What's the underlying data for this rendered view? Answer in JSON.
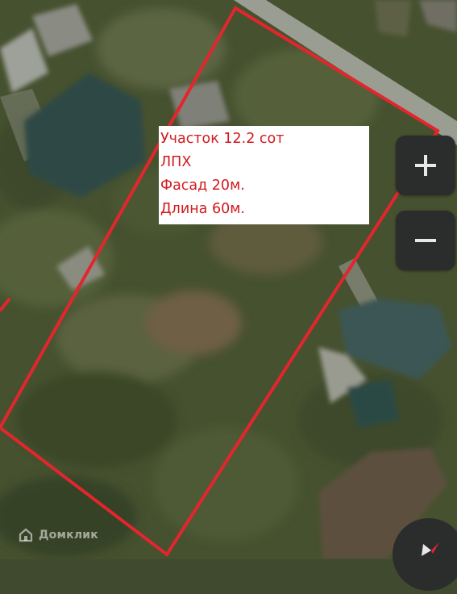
{
  "map": {
    "view": "satellite",
    "plot_outline_color": "#e3262d"
  },
  "info_box": {
    "lines": [
      "Участок 12.2 сот",
      "ЛПХ",
      "Фасад 20м.",
      "Длина 60м."
    ],
    "text_color": "#d2191f"
  },
  "controls": {
    "zoom_in_icon": "plus-icon",
    "zoom_out_icon": "minus-icon",
    "compass_icon": "compass-arrow-icon"
  },
  "watermark": {
    "text": "Домклик"
  }
}
